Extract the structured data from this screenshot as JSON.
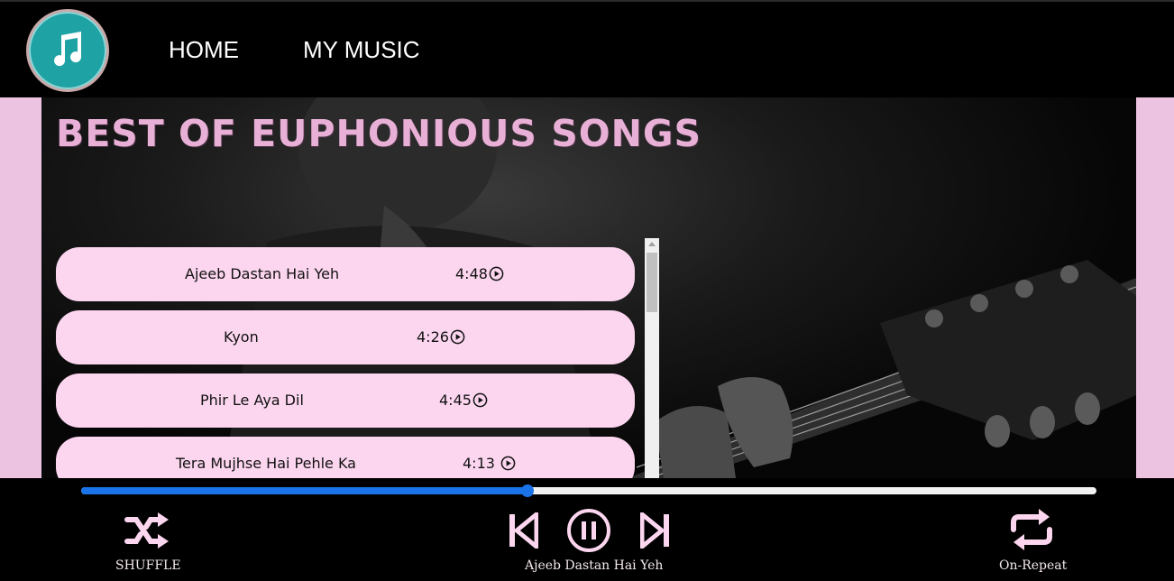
{
  "nav": {
    "home": "HOME",
    "my_music": "MY MUSIC"
  },
  "page": {
    "title": "BEST OF EUPHONIOUS SONGS"
  },
  "songs": [
    {
      "name": "Ajeeb Dastan Hai Yeh",
      "duration": "4:48"
    },
    {
      "name": "Kyon",
      "duration": "4:26"
    },
    {
      "name": "Phir Le Aya Dil",
      "duration": "4:45"
    },
    {
      "name": "Tera Mujhse Hai Pehle Ka",
      "duration": "4:13"
    }
  ],
  "player": {
    "shuffle_label": "SHUFFLE",
    "now_playing": "Ajeeb Dastan Hai Yeh",
    "repeat_label": "On-Repeat",
    "progress_fraction": 0.44
  },
  "colors": {
    "accent": "#1a73e8",
    "song_bg": "#fcd6ef",
    "title": "#e8b0d6",
    "control": "#fcd6ef",
    "side_bg": "#ecc3e0",
    "logo": "#1fa2a4"
  },
  "icons": {
    "logo": "music-note-icon",
    "play": "play-circle-icon",
    "shuffle": "shuffle-icon",
    "previous": "skip-previous-icon",
    "pause": "pause-circle-icon",
    "next": "skip-next-icon",
    "repeat": "repeat-icon"
  }
}
